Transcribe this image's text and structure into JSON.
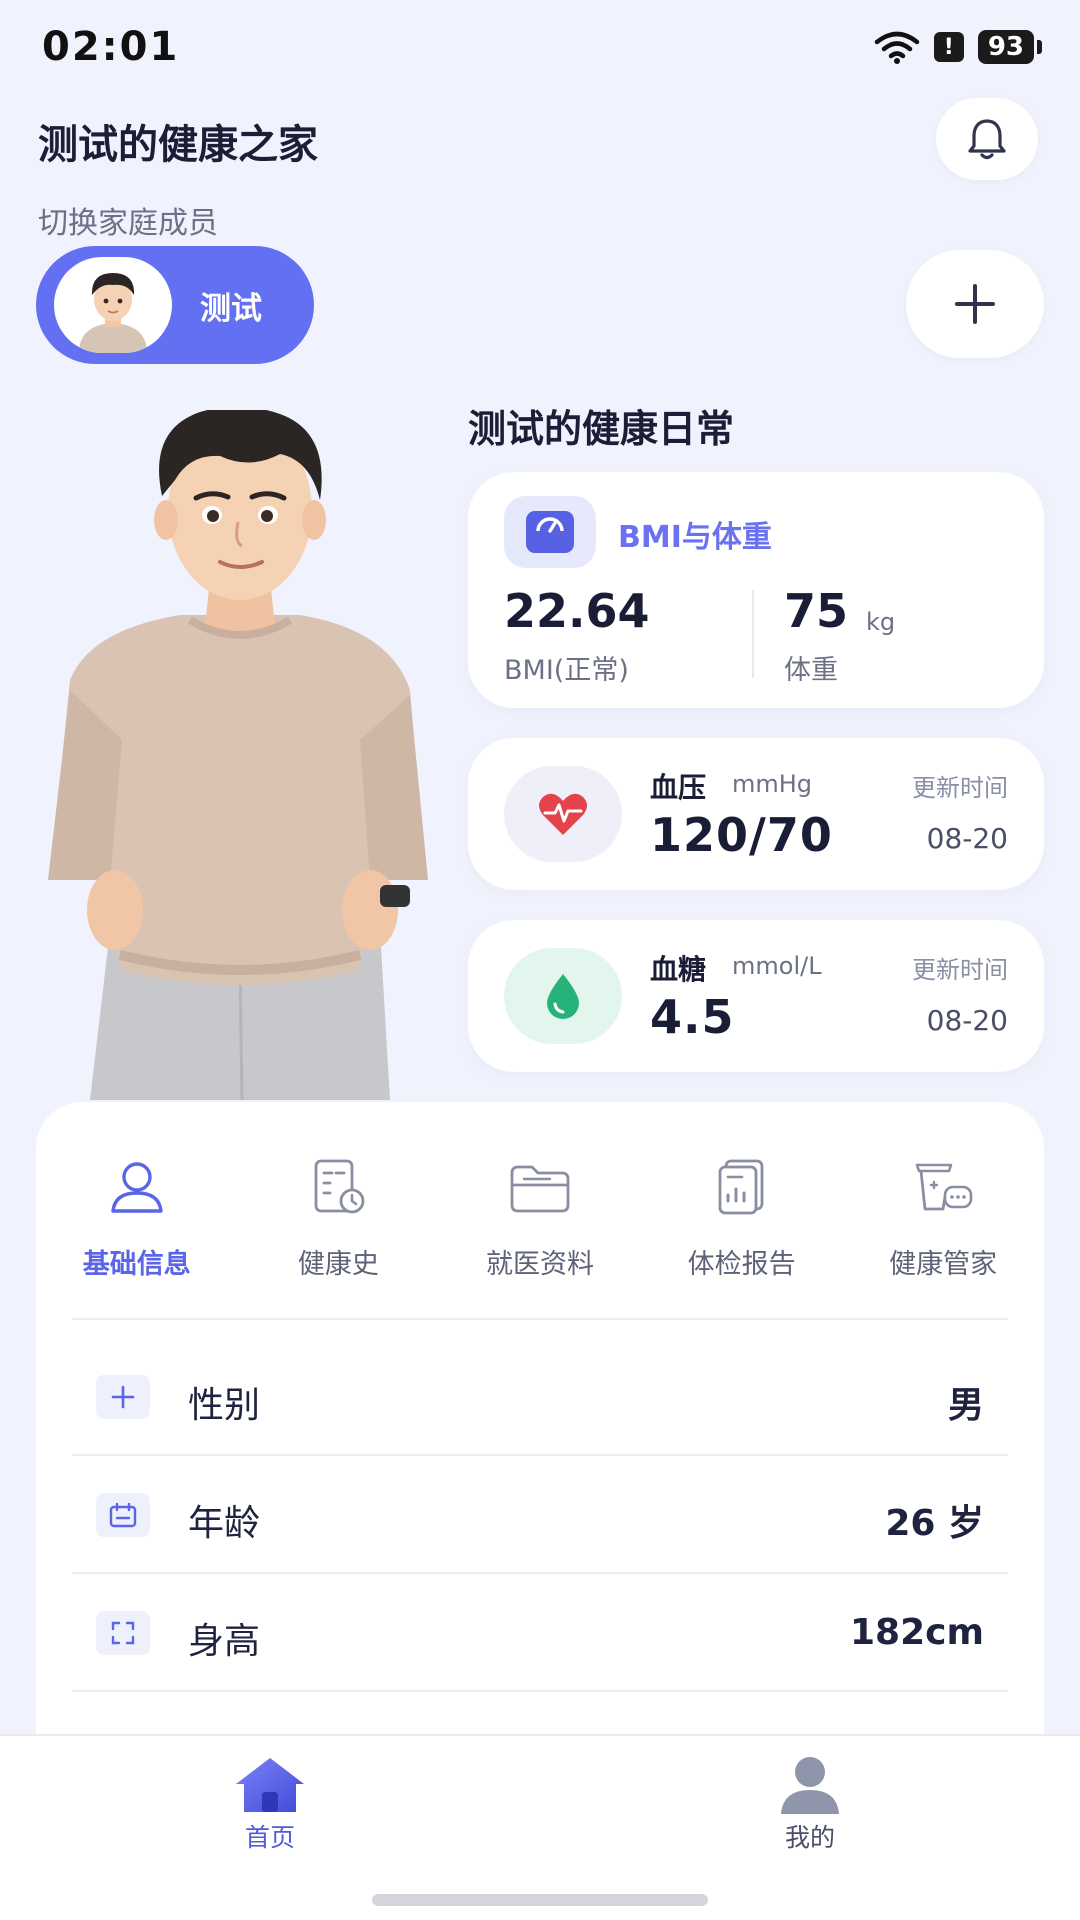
{
  "status_bar": {
    "time": "02:01",
    "battery": "93",
    "alert": "!"
  },
  "header": {
    "title": "测试的健康之家"
  },
  "family": {
    "switch_label": "切换家庭成员",
    "member_name": "测试"
  },
  "daily": {
    "title": "测试的健康日常"
  },
  "bmi_card": {
    "title": "BMI与体重",
    "bmi_value": "22.64",
    "bmi_label": "BMI(正常)",
    "weight_value": "75",
    "weight_unit": "kg",
    "weight_label": "体重"
  },
  "blood_pressure": {
    "name": "血压",
    "unit": "mmHg",
    "value": "120/70",
    "update_label": "更新时间",
    "update_date": "08-20",
    "icon_color": "#e5434b"
  },
  "blood_glucose": {
    "name": "血糖",
    "unit": "mmol/L",
    "value": "4.5",
    "update_label": "更新时间",
    "update_date": "08-20",
    "icon_color": "#27b27a"
  },
  "tabs": [
    {
      "label": "基础信息",
      "icon": "user-icon",
      "active": true
    },
    {
      "label": "健康史",
      "icon": "clipboard-clock-icon",
      "active": false
    },
    {
      "label": "就医资料",
      "icon": "folder-icon",
      "active": false
    },
    {
      "label": "体检报告",
      "icon": "report-icon",
      "active": false
    },
    {
      "label": "健康管家",
      "icon": "cup-chat-icon",
      "active": false
    }
  ],
  "basic_info": [
    {
      "label": "性别",
      "value": "男",
      "icon": "plus-icon"
    },
    {
      "label": "年龄",
      "value": "26 岁",
      "icon": "calendar-icon"
    },
    {
      "label": "身高",
      "value": "182cm",
      "icon": "expand-icon"
    }
  ],
  "bottom_nav": [
    {
      "label": "首页",
      "icon": "home-icon",
      "active": true
    },
    {
      "label": "我的",
      "icon": "person-icon",
      "active": false
    }
  ],
  "colors": {
    "accent": "#6370f1",
    "background": "#f0f3fd"
  }
}
